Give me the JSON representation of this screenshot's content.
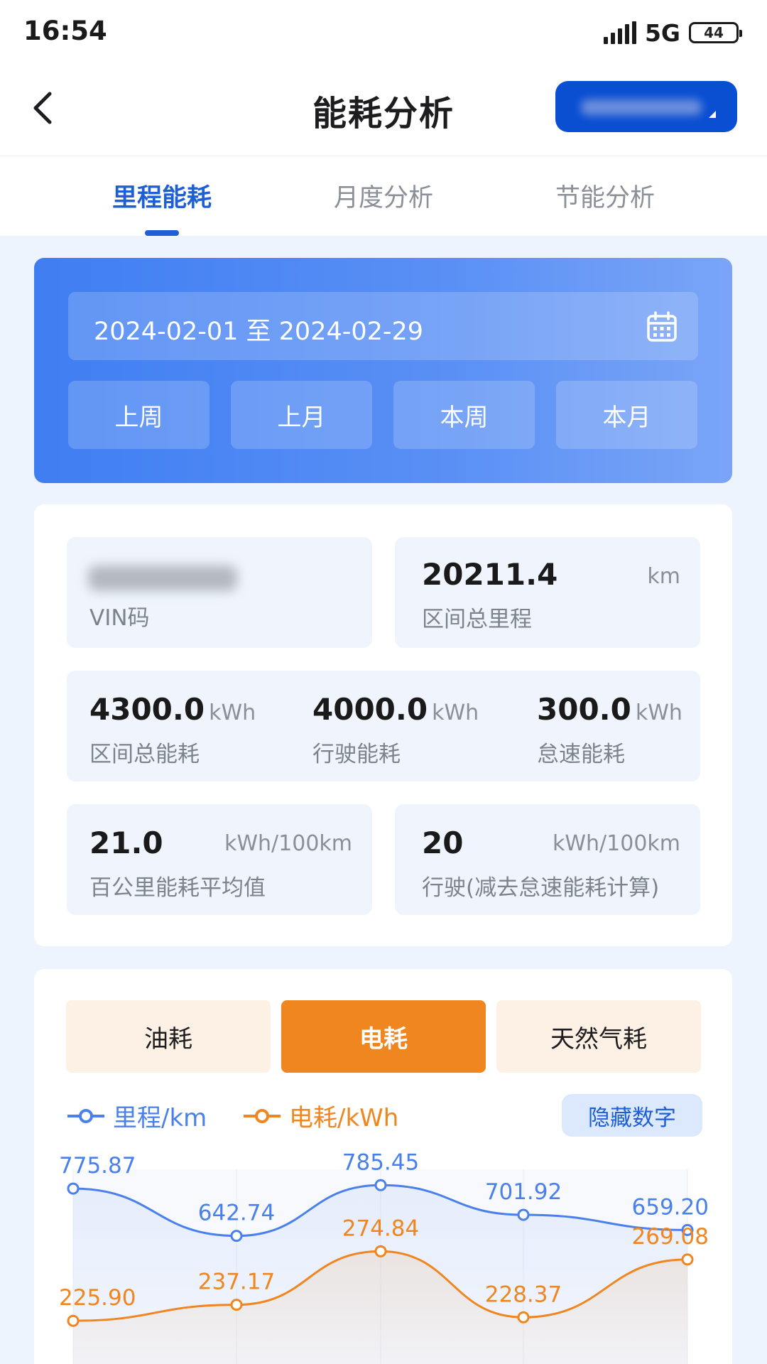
{
  "status_bar": {
    "time": "16:54",
    "network": "5G",
    "battery": "44"
  },
  "header": {
    "title": "能耗分析"
  },
  "tabs": [
    {
      "label": "里程能耗",
      "active": true
    },
    {
      "label": "月度分析",
      "active": false
    },
    {
      "label": "节能分析",
      "active": false
    }
  ],
  "date_filter": {
    "range": "2024-02-01 至 2024-02-29",
    "quick": [
      "上周",
      "上月",
      "本周",
      "本月"
    ]
  },
  "stats": {
    "vin_label": "VIN码",
    "mileage": {
      "value": "20211.4",
      "unit": "km",
      "label": "区间总里程"
    },
    "total_energy": {
      "value": "4300.0",
      "unit": "kWh",
      "label": "区间总能耗"
    },
    "driving_energy": {
      "value": "4000.0",
      "unit": "kWh",
      "label": "行驶能耗"
    },
    "idle_energy": {
      "value": "300.0",
      "unit": "kWh",
      "label": "怠速能耗"
    },
    "avg_100km": {
      "value": "21.0",
      "unit": "kWh/100km",
      "label": "百公里能耗平均值"
    },
    "driving_100km": {
      "value": "20",
      "unit": "kWh/100km",
      "label": "行驶(减去怠速能耗计算)"
    }
  },
  "energy_types": [
    {
      "label": "油耗",
      "active": false
    },
    {
      "label": "电耗",
      "active": true
    },
    {
      "label": "天然气耗",
      "active": false
    }
  ],
  "hide_numbers_label": "隐藏数字",
  "colors": {
    "primary": "#1f5fd6",
    "mileage_line": "#4a80ec",
    "energy_line": "#ef861f"
  },
  "chart_data": {
    "type": "line",
    "series": [
      {
        "name": "里程/km",
        "values": [
          775.87,
          642.74,
          785.45,
          701.92,
          659.2
        ],
        "labels": [
          "775.87",
          "642.74",
          "785.45",
          "701.92",
          "659.20"
        ]
      },
      {
        "name": "电耗/kWh",
        "values": [
          225.9,
          237.17,
          274.84,
          228.37,
          269.08
        ],
        "labels": [
          "225.90",
          "237.17",
          "274.84",
          "228.37",
          "269.08"
        ]
      }
    ],
    "grid": true,
    "legend": "top-left"
  }
}
